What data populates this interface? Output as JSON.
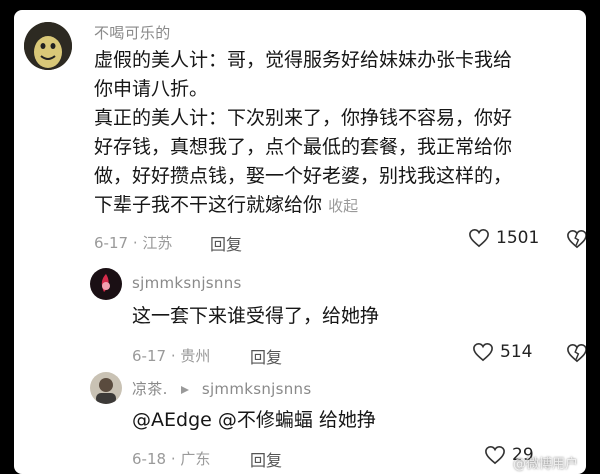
{
  "comments": [
    {
      "username": "不喝可乐的",
      "lines": [
        "虚假的美人计：哥，觉得服务好给妹妹办张卡我给",
        "你申请八折。",
        "真正的美人计：下次别来了，你挣钱不容易，你好",
        "好存钱，真想我了，点个最低的套餐，我正常给你",
        "做，好好攒点钱，娶一个好老婆，别找我这样的，",
        "下辈子我不干这行就嫁给你"
      ],
      "collapse_label": "收起",
      "date": "6-17",
      "location": "江苏",
      "reply_label": "回复",
      "likes": "1501"
    },
    {
      "username": "sjmmksnjsnns",
      "text": "这一套下来谁受得了，给她挣",
      "date": "6-17",
      "location": "贵州",
      "reply_label": "回复",
      "likes": "514"
    },
    {
      "username": "凉茶.",
      "reply_to": "sjmmksnjsnns",
      "text": "@AEdge @不修蝙蝠 给她挣",
      "date": "6-18",
      "location": "广东",
      "reply_label": "回复",
      "likes": "29"
    }
  ],
  "watermark": "@微博用户",
  "colors": {
    "text": "#161616",
    "meta": "#9a9a9a",
    "username": "#8a8a8a"
  },
  "icons": [
    "heart-outline-icon",
    "dislike-heart-icon",
    "reply-arrow-icon"
  ]
}
